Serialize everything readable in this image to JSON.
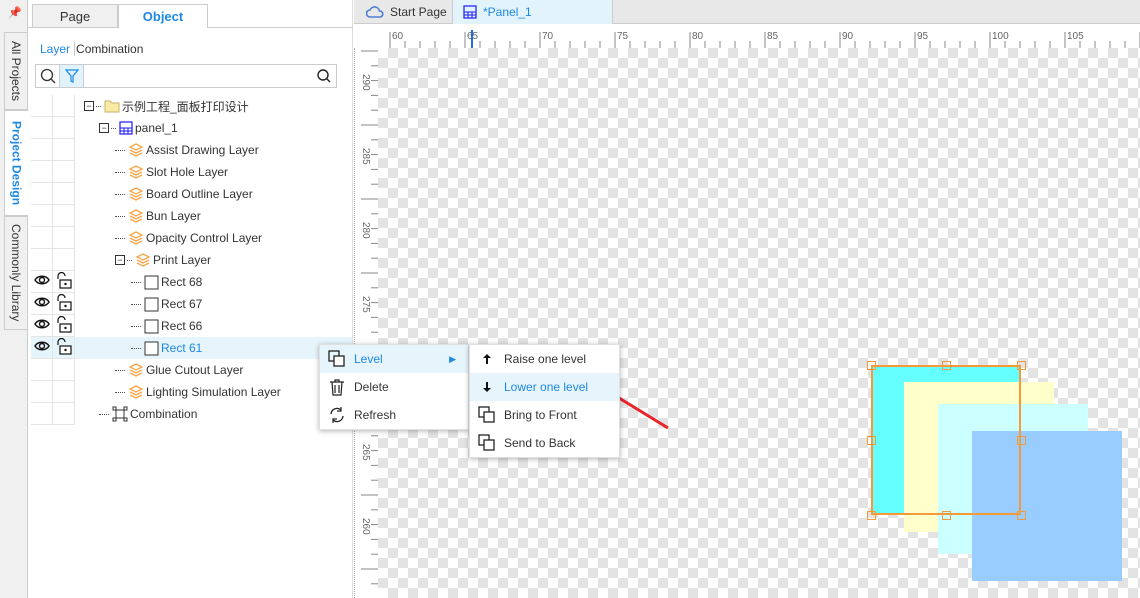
{
  "side_tabs": [
    "All Projects",
    "Project Design",
    "Commonly Library"
  ],
  "panel": {
    "tabs": [
      "Page",
      "Object"
    ],
    "active_tab": "Object",
    "subtabs": [
      "Layer",
      "Combination"
    ],
    "search": {
      "value": "",
      "placeholder": ""
    }
  },
  "tree": [
    {
      "label": "示例工程_面板打印设计",
      "icon": "folder-icon",
      "level": 0,
      "expander": true
    },
    {
      "label": "panel_1",
      "icon": "panel-icon",
      "level": 1,
      "expander": true
    },
    {
      "label": "Assist Drawing Layer",
      "icon": "layer-icon",
      "level": 2
    },
    {
      "label": "Slot Hole Layer",
      "icon": "layer-icon",
      "level": 2
    },
    {
      "label": "Board Outline Layer",
      "icon": "layer-icon",
      "level": 2
    },
    {
      "label": "Bun Layer",
      "icon": "layer-icon",
      "level": 2
    },
    {
      "label": "Opacity Control Layer",
      "icon": "layer-icon",
      "level": 2
    },
    {
      "label": "Print Layer",
      "icon": "layer-icon",
      "level": 2,
      "expander": true
    },
    {
      "label": "Rect 68",
      "icon": "rect-icon",
      "level": 3,
      "eye": true,
      "lock": true
    },
    {
      "label": "Rect 67",
      "icon": "rect-icon",
      "level": 3,
      "eye": true,
      "lock": true
    },
    {
      "label": "Rect 66",
      "icon": "rect-icon",
      "level": 3,
      "eye": true,
      "lock": true
    },
    {
      "label": "Rect 61",
      "icon": "rect-icon",
      "level": 3,
      "eye": true,
      "lock": true,
      "selected": true
    },
    {
      "label": "Glue Cutout Layer",
      "icon": "layer-icon",
      "level": 2
    },
    {
      "label": "Lighting Simulation Layer",
      "icon": "layer-icon",
      "level": 2
    },
    {
      "label": "Combination",
      "icon": "combination-icon",
      "level": 1
    }
  ],
  "editor_tabs": [
    {
      "label": "Start Page",
      "icon": "cloud-icon"
    },
    {
      "label": "*Panel_1",
      "icon": "panel-icon",
      "active": true
    }
  ],
  "ruler": {
    "h_labels": [
      "60",
      "65",
      "70",
      "75",
      "80",
      "85",
      "90",
      "95",
      "100",
      "105"
    ],
    "v_labels": [
      "290",
      "285",
      "280",
      "275",
      "270",
      "265",
      "260"
    ]
  },
  "context_menu": {
    "items": [
      {
        "label": "Level",
        "icon": "level-icon",
        "has_submenu": true,
        "highlighted": true
      },
      {
        "label": "Delete",
        "icon": "trash-icon"
      },
      {
        "label": "Refresh",
        "icon": "refresh-icon"
      }
    ]
  },
  "submenu": {
    "items": [
      {
        "label": "Raise one level",
        "icon": "arrow-up-icon"
      },
      {
        "label": "Lower one level",
        "icon": "arrow-down-icon",
        "highlighted": true
      },
      {
        "label": "Bring to Front",
        "icon": "bring-front-icon"
      },
      {
        "label": "Send to Back",
        "icon": "send-back-icon"
      }
    ]
  },
  "colors": {
    "accent": "#1e88e5",
    "layer_icon": "#f5a54a",
    "selection": "#f59a3a",
    "rect_61": "#66ffff",
    "rect_66": "#ffffcc",
    "rect_67": "#ccffff",
    "rect_68": "#99ccff",
    "annotation_arrow": "#e8262a"
  }
}
